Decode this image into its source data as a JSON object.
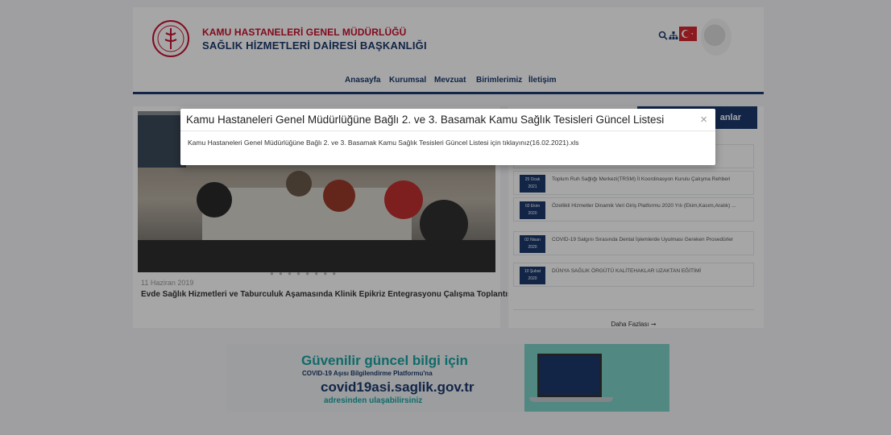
{
  "header": {
    "org_line1": "KAMU HASTANELERİ GENEL MÜDÜRLÜĞÜ",
    "org_line2": "SAĞLIK HİZMETLERİ DAİRESİ BAŞKANLIĞI",
    "search_icon": "search-icon",
    "sitemap_icon": "sitemap-icon"
  },
  "nav": {
    "items": [
      "Anasayfa",
      "Kurumsal",
      "Mevzuat",
      "Birimlerimiz",
      "İletişim"
    ]
  },
  "slider": {
    "date": "11 Haziran 2019",
    "title": "Evde Sağlık Hizmetleri ve Taburculuk Aşamasında Klinik Epikriz Entegrasyonu Çalışma Toplantısı",
    "dots": "● ● ● ● ● ● ● ●"
  },
  "announcements": {
    "header_partial": "anlar",
    "items": [
      {
        "date_top": "25 Ocak",
        "date_bottom": "2021",
        "title": "Toplum Ruh Sağlığı Merkezi(TRSM) İl Koordinasyon Kurulu Çalışma Rehberi"
      },
      {
        "date_top": "02 Ekim",
        "date_bottom": "2020",
        "title": "Özellikli Hizmetler Dinamik Veri Giriş Platformu 2020 Yılı (Ekim,Kasım,Aralık) ..."
      },
      {
        "date_top": "02 Nisan",
        "date_bottom": "2020",
        "title": "COVID-19 Salgını Sırasında Dental İşlemlerde Uyulması Gereken Prosedürler"
      },
      {
        "date_top": "10 Şubat",
        "date_bottom": "2020",
        "title": "DÜNYA SAĞLIK ÖRGÜTÜ KALİTEHAKLAR UZAKTAN EĞİTİMİ"
      }
    ],
    "more_label": "Daha Fazlası ➞"
  },
  "banner": {
    "line1": "Güvenilir güncel bilgi için",
    "line2": "COVID-19 Aşısı Bilgilendirme Platformu'na",
    "line3": "covid19asi.saglik.gov.tr",
    "line4": "adresinden ulaşabilirsiniz"
  },
  "modal": {
    "title": "Kamu Hastaneleri Genel Müdürlüğüne Bağlı 2. ve 3. Basamak Kamu Sağlık Tesisleri Güncel Listesi",
    "link_text": "Kamu Hastaneleri Genel Müdürlüğüne Bağlı 2. ve 3. Basamak Kamu Sağlık Tesisleri Güncel Listesi için tıklayınız(16.02.2021).xls",
    "close_label": "×"
  },
  "colors": {
    "brand_navy": "#1d3a6e",
    "brand_red": "#c8102e",
    "banner_teal": "#1aa3a1"
  }
}
